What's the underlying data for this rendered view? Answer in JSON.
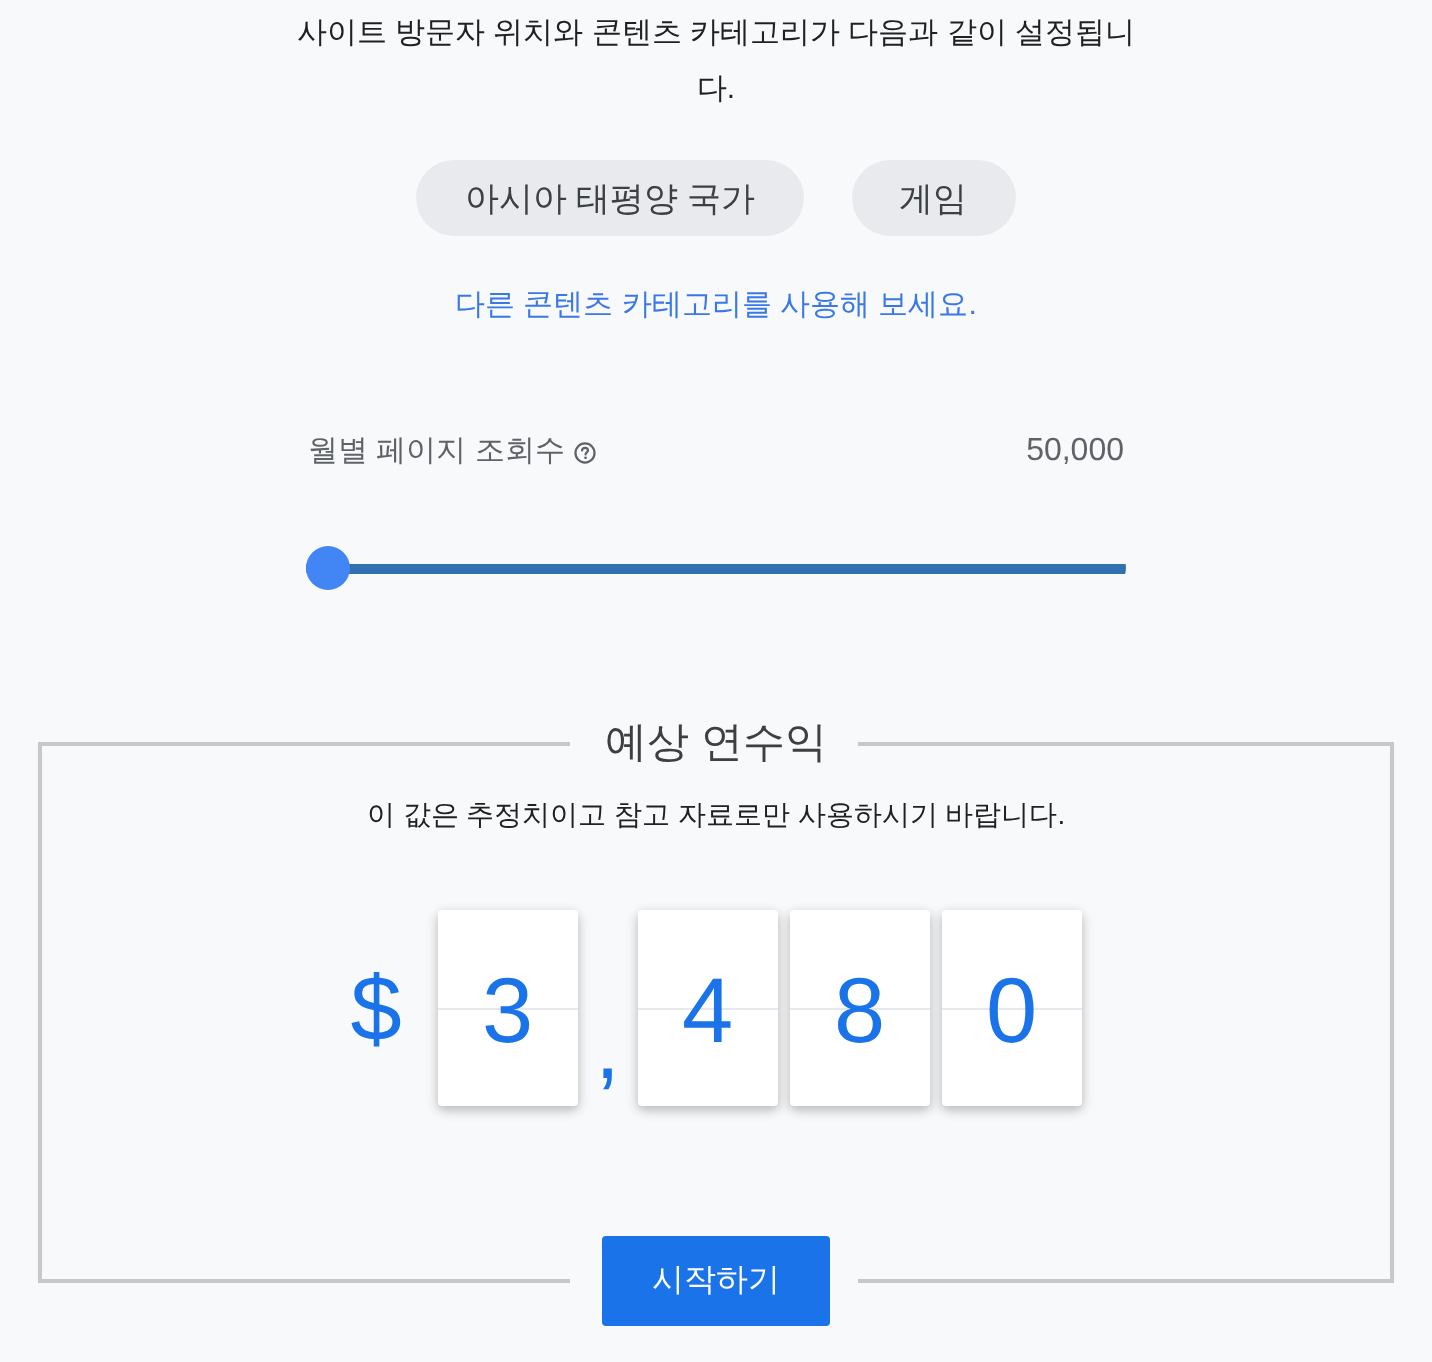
{
  "intro": "사이트 방문자 위치와 콘텐츠 카테고리가 다음과 같이 설정됩니다.",
  "chips": [
    {
      "label": "아시아 태평양 국가"
    },
    {
      "label": "게임"
    }
  ],
  "link": "다른 콘텐츠 카테고리를 사용해 보세요.",
  "pageviews": {
    "label": "월별 페이지 조회수",
    "value": "50,000",
    "level": 0
  },
  "earnings": {
    "title": "예상 연수익",
    "note": "이 값은 추정치이고 참고 자료로만 사용하시기 바랍니다.",
    "currency": "$",
    "digits": [
      {
        "kind": "digit",
        "text": "3"
      },
      {
        "kind": "separator",
        "text": ","
      },
      {
        "kind": "digit",
        "text": "4"
      },
      {
        "kind": "digit",
        "text": "8"
      },
      {
        "kind": "digit",
        "text": "0"
      }
    ]
  },
  "button": "시작하기"
}
